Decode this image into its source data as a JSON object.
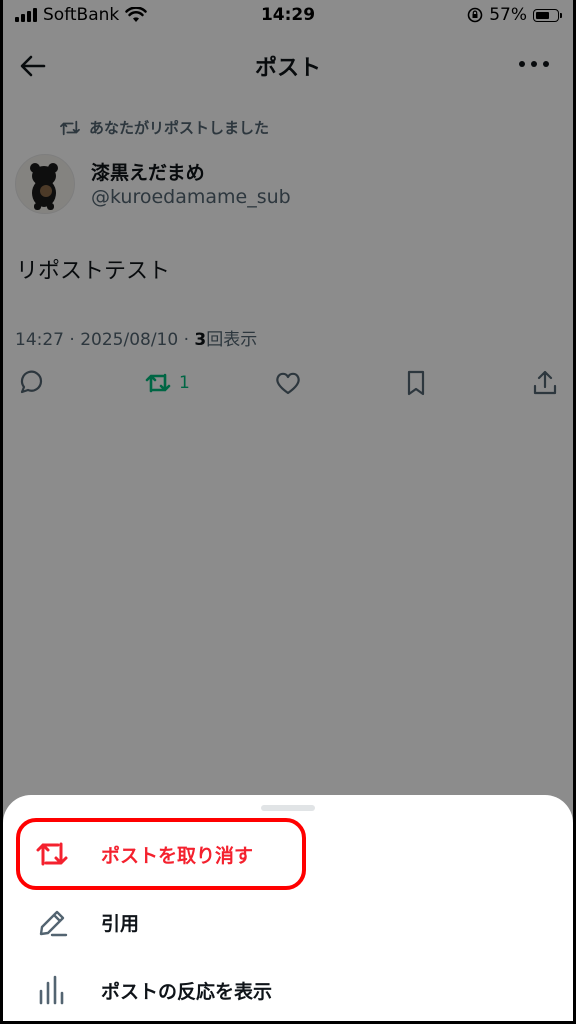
{
  "status_bar": {
    "carrier": "SoftBank",
    "time": "14:29",
    "battery_percent": "57%"
  },
  "header": {
    "title": "ポスト"
  },
  "post": {
    "repost_note": "あなたがリポストしました",
    "author_name": "漆黒えだまめ",
    "author_handle": "@kuroedamame_sub",
    "text": "リポストテスト",
    "timestamp": "14:27 · 2025/08/10 · ",
    "view_count": "3",
    "view_label": "回表示",
    "repost_count": "1"
  },
  "sheet": {
    "items": [
      {
        "label": "ポストを取り消す",
        "icon": "repost-icon"
      },
      {
        "label": "引用",
        "icon": "pencil-icon"
      },
      {
        "label": "ポストの反応を表示",
        "icon": "analytics-icon"
      }
    ]
  },
  "colors": {
    "repost_green": "#00ba7c",
    "destructive_red": "#f4212e",
    "highlight_red": "#ff0000",
    "text_primary": "#0f1419",
    "text_secondary": "#536471"
  }
}
